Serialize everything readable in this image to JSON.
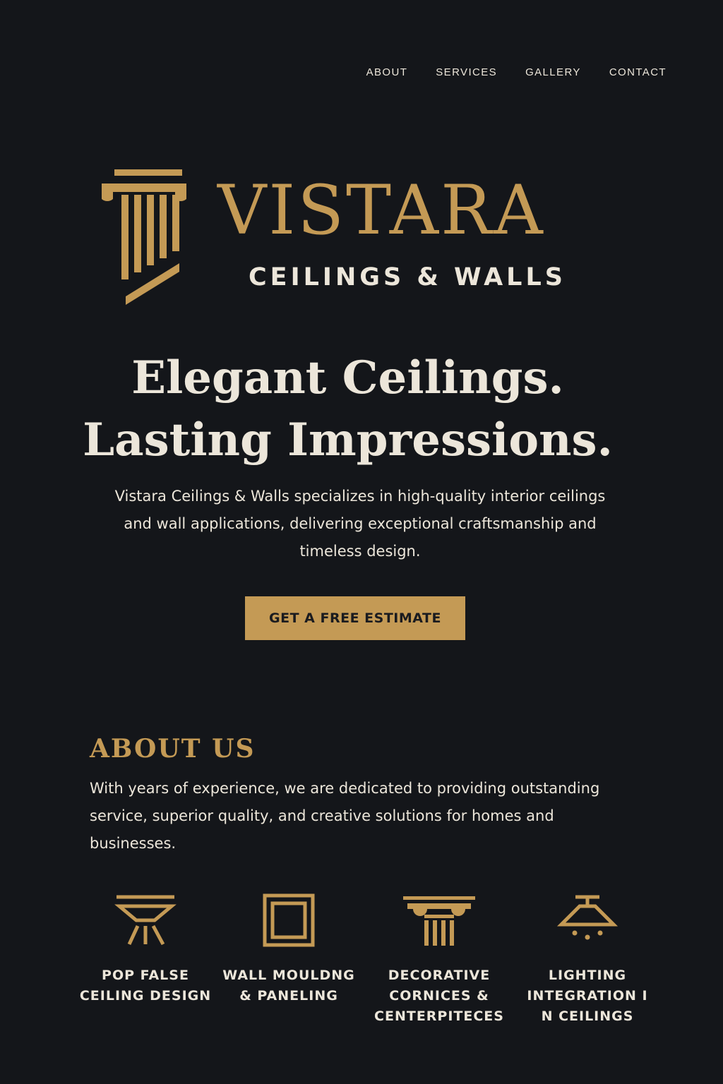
{
  "nav": {
    "items": [
      "ABOUT",
      "SERVICES",
      "GALLERY",
      "CONTACT"
    ]
  },
  "logo": {
    "brand": "VISTARA",
    "subtitle": "CEILINGS & WALLS",
    "icon": "pillar-icon"
  },
  "hero": {
    "title_line1": "Elegant Ceilings.",
    "title_line2": "Lasting Impressions.",
    "description": "Vistara Ceilings & Walls specializes in high-quality interior ceilings and wall applications, delivering exceptional craftsmanship and timeless design.",
    "cta_label": "GET A FREE ESTIMATE"
  },
  "about": {
    "title": "ABOUT US",
    "text": "With years of experience, we are dedicated to providing outstanding service, superior quality, and creative solutions for homes and businesses."
  },
  "services": [
    {
      "label": "POP FALSE\nCEILING DESIGN",
      "icon": "ceiling-light-icon"
    },
    {
      "label": "WALL MOULDNG\n& PANELING",
      "icon": "panel-frame-icon"
    },
    {
      "label": "DECORATIVE\nCORNICES &\nCENTERPITECES",
      "icon": "cornice-column-icon"
    },
    {
      "label": "LIGHTING\nINTEGRATION I\nN CEILINGS",
      "icon": "pendant-lamp-icon"
    }
  ],
  "colors": {
    "background": "#14161a",
    "gold": "#c49a55",
    "text": "#ece6da"
  }
}
